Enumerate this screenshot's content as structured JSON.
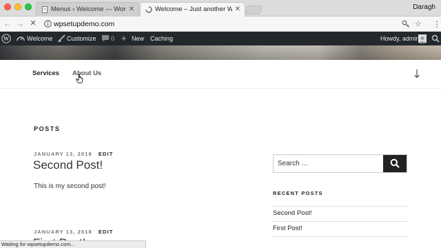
{
  "browser": {
    "tabs": [
      {
        "title": "Menus ‹ Welcome — WordPress",
        "active": false
      },
      {
        "title": "Welcome – Just another WordPress site",
        "active": true
      }
    ],
    "close_glyph": "✕",
    "profile_name": "Daragh",
    "url": "wpsetupdemo.com",
    "status_text": "Waiting for wpsetupdemo.com..."
  },
  "admin_bar": {
    "site_name": "Welcome",
    "customize": "Customize",
    "comments_count": "0",
    "new": "New",
    "caching": "Caching",
    "greeting": "Howdy, admin"
  },
  "site_nav": {
    "items": [
      "Services",
      "About Us"
    ]
  },
  "content": {
    "section_title": "POSTS",
    "posts": [
      {
        "date": "JANUARY 13, 2018",
        "edit": "EDIT",
        "title": "Second Post!",
        "excerpt": "This is my second post!"
      },
      {
        "date": "JANUARY 13, 2018",
        "edit": "EDIT",
        "title": "First Post!"
      }
    ]
  },
  "sidebar": {
    "search_placeholder": "Search …",
    "recent_title": "RECENT POSTS",
    "recent_posts": [
      "Second Post!",
      "First Post!"
    ]
  },
  "colors": {
    "admin_bar_bg": "#23282d",
    "search_button_bg": "#222222"
  }
}
